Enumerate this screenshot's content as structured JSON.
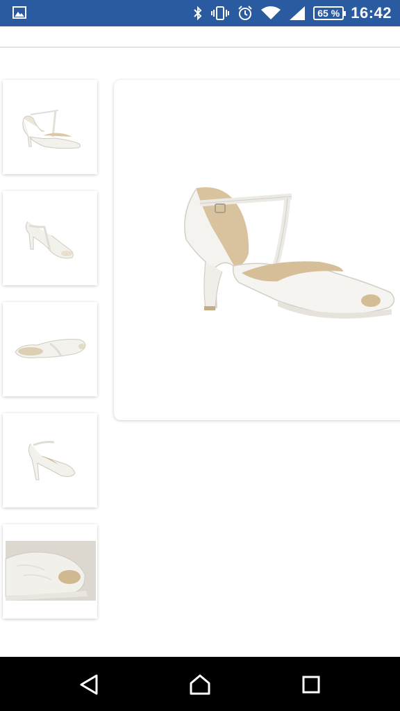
{
  "status_bar": {
    "battery_level": "65 %",
    "time": "16:42",
    "icons": [
      "image-notification-icon",
      "bluetooth-icon",
      "vibrate-icon",
      "alarm-icon",
      "wifi-icon",
      "signal-icon",
      "battery-icon"
    ],
    "background_color": "#2a5a9f"
  },
  "gallery": {
    "selected_index": 0,
    "thumbnails": [
      {
        "name": "side-view"
      },
      {
        "name": "angled-front-view"
      },
      {
        "name": "top-view"
      },
      {
        "name": "back-view"
      },
      {
        "name": "toe-detail-view"
      }
    ]
  },
  "nav_bar": {
    "buttons": [
      "back-icon",
      "home-icon",
      "recents-icon"
    ]
  }
}
